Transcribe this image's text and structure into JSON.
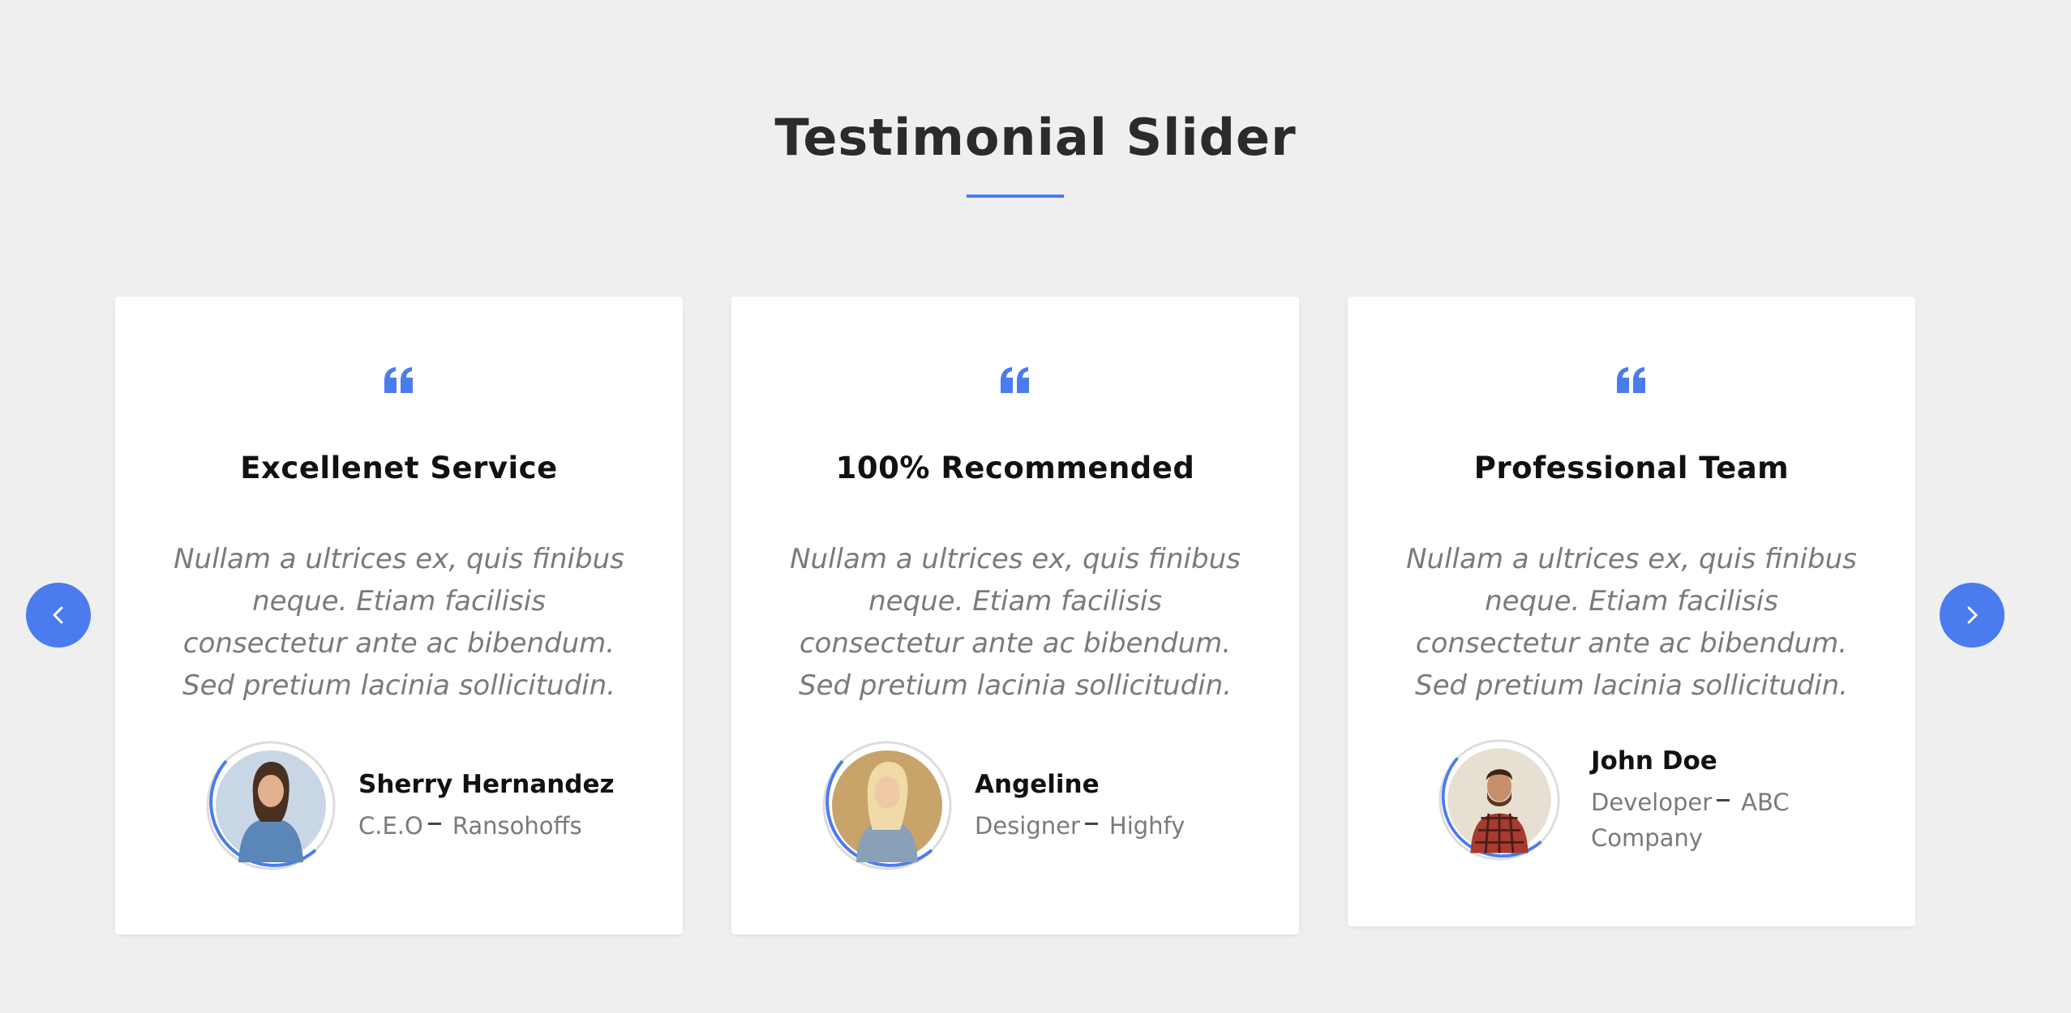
{
  "section": {
    "title": "Testimonial Slider",
    "accent_color": "#4a7cf0"
  },
  "navigation": {
    "prev_icon": "chevron-left-icon",
    "next_icon": "chevron-right-icon"
  },
  "quote_icon": "quote-icon",
  "testimonials": [
    {
      "heading": "Excellenet Service",
      "text": "Nullam a ultrices ex, quis finibus neque. Etiam facilisis consectetur ante ac bibendum. Sed pretium lacinia sollicitudin.",
      "name": "Sherry Hernandez",
      "role": "C.E.O",
      "company": "Ransohoffs"
    },
    {
      "heading": "100% Recommended",
      "text": "Nullam a ultrices ex, quis finibus neque. Etiam facilisis consectetur ante ac bibendum. Sed pretium lacinia sollicitudin.",
      "name": "Angeline",
      "role": "Designer",
      "company": "Highfy"
    },
    {
      "heading": "Professional Team",
      "text": "Nullam a ultrices ex, quis finibus neque. Etiam facilisis consectetur ante ac bibendum. Sed pretium lacinia sollicitudin.",
      "name": "John Doe",
      "role": "Developer",
      "company": "ABC Company"
    }
  ]
}
